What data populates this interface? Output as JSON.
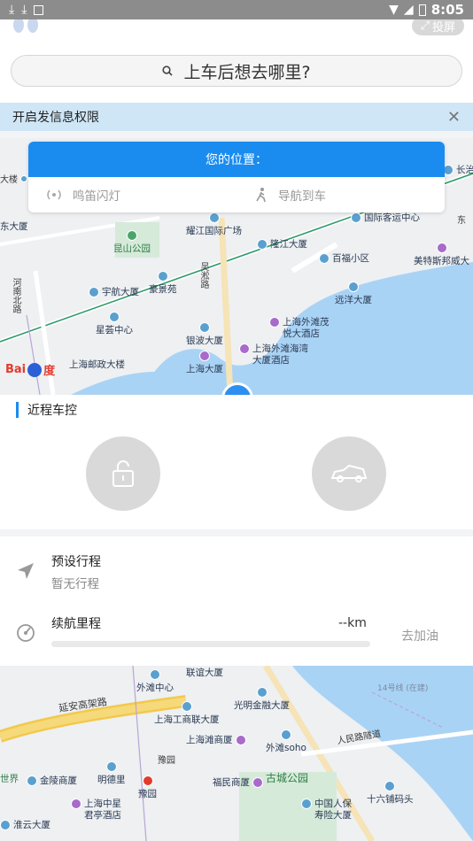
{
  "statusbar": {
    "time": "8:05"
  },
  "header": {
    "complain_label": "投屏"
  },
  "search": {
    "placeholder_text": "上车后想去哪里?"
  },
  "notice": {
    "text": "开启发信息权限",
    "close": "✕"
  },
  "location_card": {
    "title": "您的位置：",
    "actions": [
      {
        "label": "鸣笛闪灯",
        "icon": "horn-icon"
      },
      {
        "label": "导航到车",
        "icon": "walk-icon"
      }
    ]
  },
  "map_top": {
    "pois": [
      "长治大",
      "国际客运中心",
      "东",
      "耀江国际广场",
      "隆江大厦",
      "百福小区",
      "美特斯邦威大",
      "昆山公园",
      "吴淞路",
      "宇航大厦",
      "豪景苑",
      "远洋大厦",
      "上海外滩茂悦大酒店",
      "上海外滩海湾大厦酒店",
      "星荟中心",
      "银波大厦",
      "上海邮政大楼",
      "上海大厦",
      "河南北路",
      "大楼",
      "东大厦"
    ]
  },
  "map_bottom": {
    "pois": [
      "联谊大厦",
      "外滩中心",
      "延安高架路",
      "光明金融大厦",
      "14号线 (在建)",
      "上海工商联大厦",
      "上海滩商厦",
      "人民路隧道",
      "外滩soho",
      "豫园",
      "古城公园",
      "金陵商厦",
      "明德里",
      "福民商厦",
      "十六铺码头",
      "淮云大厦",
      "上海中星君亭酒店",
      "中国人保寿险大厦",
      "世界"
    ]
  },
  "remote_control": {
    "title": "近程车控"
  },
  "trip": {
    "label": "预设行程",
    "value": "暂无行程"
  },
  "range": {
    "label": "续航里程",
    "value": "--km",
    "action": "去加油"
  }
}
